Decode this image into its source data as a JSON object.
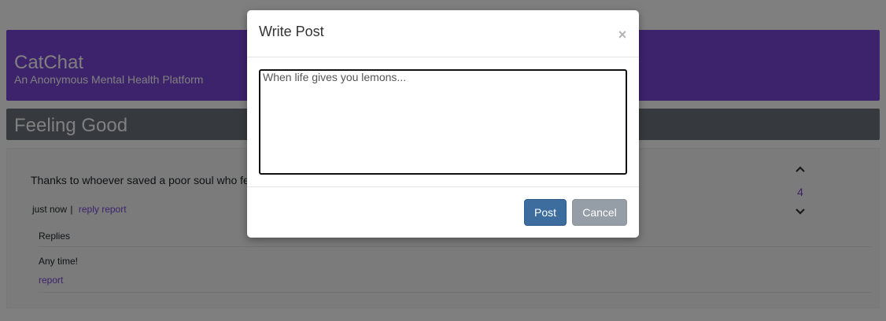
{
  "header": {
    "title": "CatChat",
    "subtitle": "An Anonymous Mental Health Platform"
  },
  "section": {
    "title": "Feeling Good"
  },
  "post": {
    "text": "Thanks to whoever saved a poor soul who fe",
    "time": "just now",
    "separator": "|",
    "reply_label": "reply",
    "report_label": "report",
    "vote_count": "4",
    "replies_header": "Replies",
    "replies": [
      {
        "text": "Any time!",
        "report_label": "report"
      }
    ]
  },
  "modal": {
    "title": "Write Post",
    "close_symbol": "×",
    "input_placeholder": "When life gives you lemons...",
    "post_button": "Post",
    "cancel_button": "Cancel"
  },
  "colors": {
    "brand_purple": "#7b46d6",
    "section_gray": "#6c757d",
    "post_button": "#3d6d9e",
    "cancel_button": "#959ea7"
  },
  "icons": {
    "upvote": "chevron-up-icon",
    "downvote": "chevron-down-icon",
    "close": "close-icon"
  }
}
